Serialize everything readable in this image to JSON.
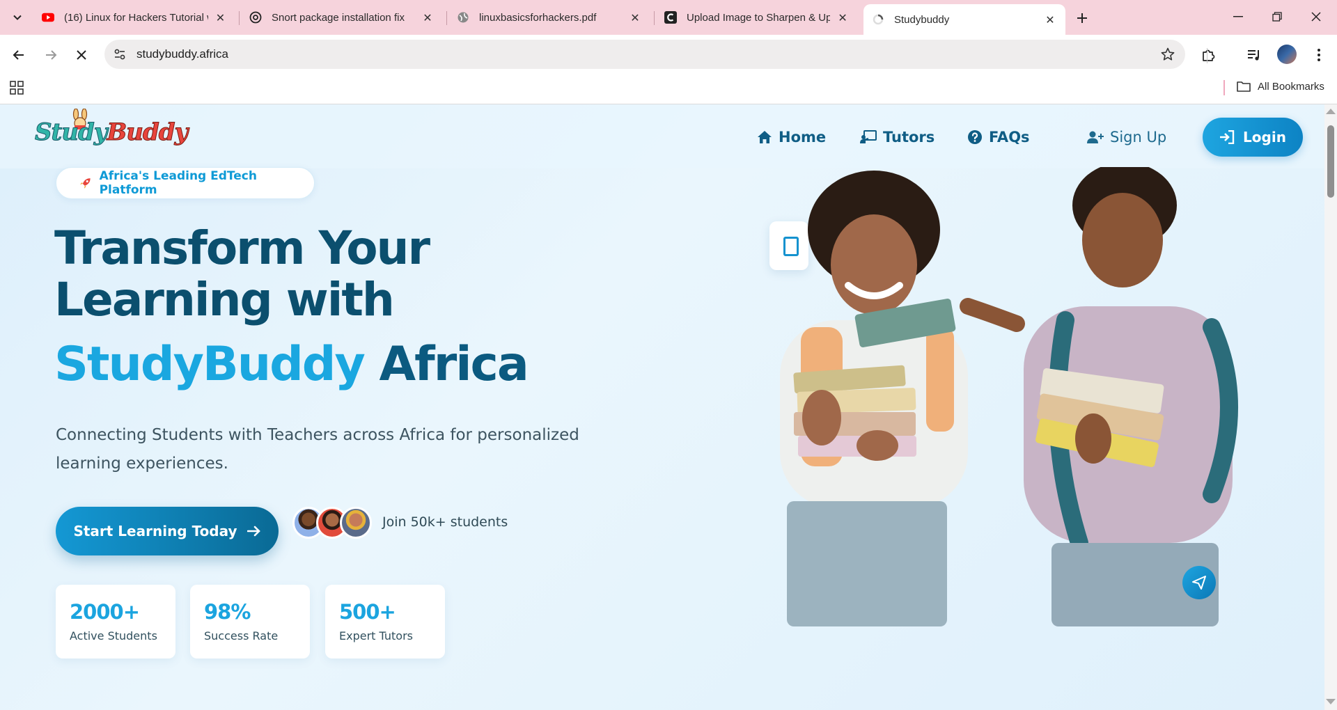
{
  "browser": {
    "tabs": [
      {
        "title": "(16) Linux for Hackers Tutorial w",
        "favicon": "youtube-icon"
      },
      {
        "title": "Snort package installation fix",
        "favicon": "openai-icon"
      },
      {
        "title": "linuxbasicsforhackers.pdf",
        "favicon": "globe-icon"
      },
      {
        "title": "Upload Image to Sharpen & Up",
        "favicon": "c-logo-icon"
      },
      {
        "title": "Studybuddy",
        "favicon": "loading-icon",
        "active": true
      }
    ],
    "url": "studybuddy.africa",
    "bookmarks": {
      "all_label": "All Bookmarks"
    }
  },
  "site": {
    "logo": {
      "part1": "Stu",
      "part2": "dy",
      "part3": "Buddy"
    },
    "nav": {
      "home": "Home",
      "tutors": "Tutors",
      "faqs": "FAQs",
      "signup": "Sign Up",
      "login": "Login"
    },
    "hero": {
      "badge": "Africa's Leading EdTech Platform",
      "title_line1": "Transform Your",
      "title_line2": "Learning with",
      "title_brand_a": "StudyBuddy",
      "title_brand_b": "Africa",
      "subtitle": "Connecting Students with Teachers across Africa for personalized learning experiences.",
      "cta": "Start Learning Today",
      "join_text": "Join 50k+ students"
    },
    "stats": [
      {
        "value": "2000+",
        "label": "Active Students"
      },
      {
        "value": "98%",
        "label": "Success Rate"
      },
      {
        "value": "500+",
        "label": "Expert Tutors"
      }
    ]
  },
  "colors": {
    "tabstrip": "#f6d3dc",
    "brand_primary": "#1aa7e0",
    "brand_dark": "#0b4f6e",
    "nav_text": "#0f5d85"
  }
}
